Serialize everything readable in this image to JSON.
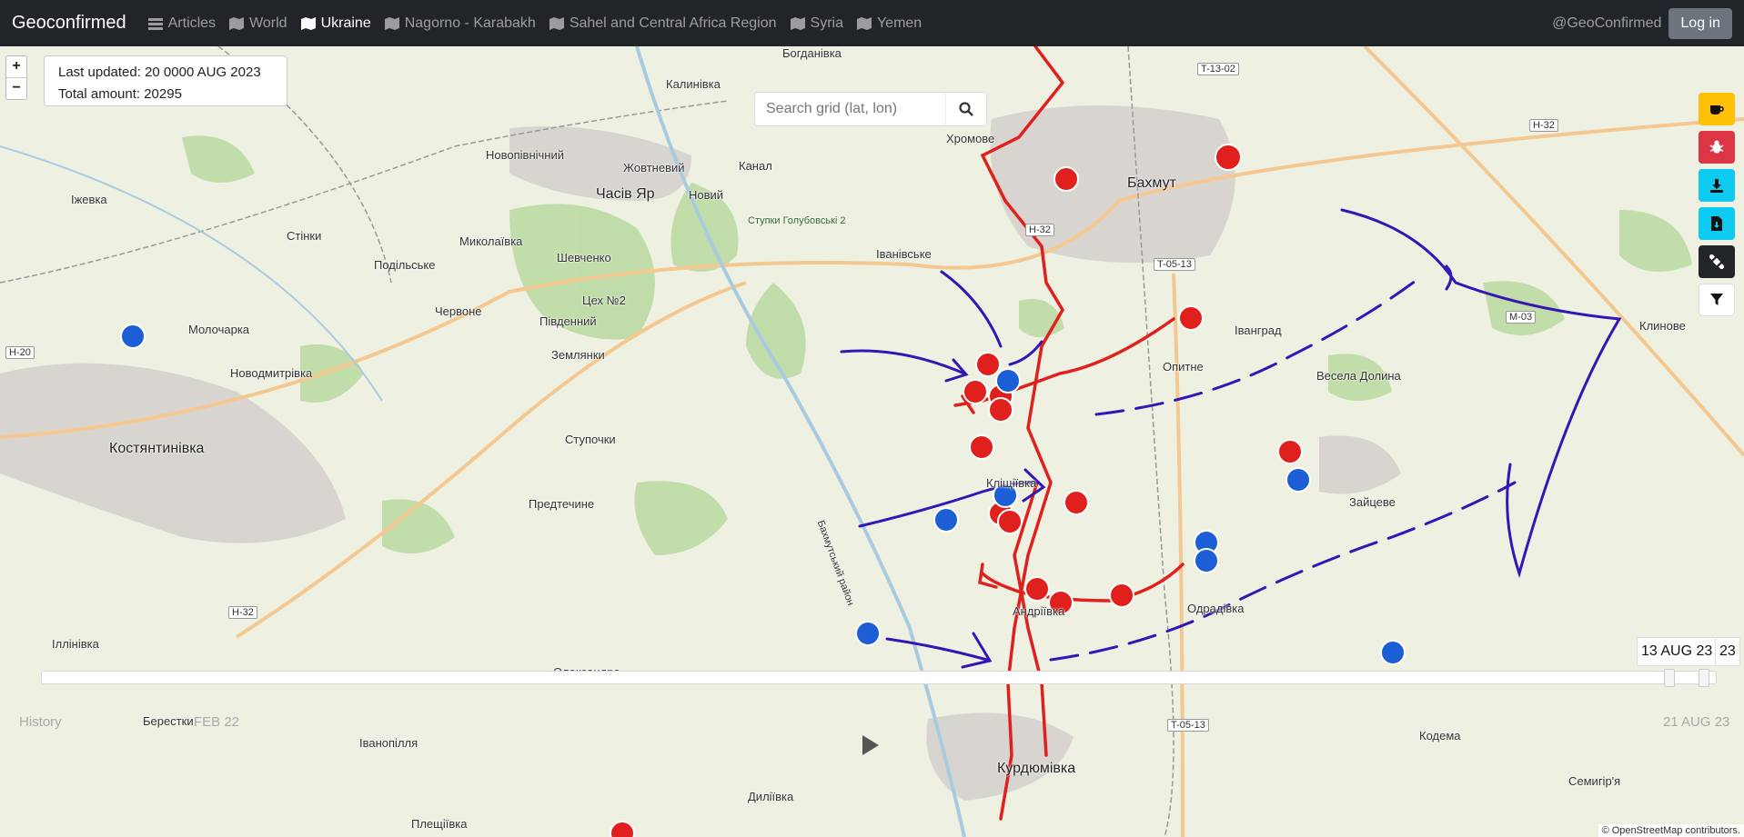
{
  "nav": {
    "brand": "Geoconfirmed",
    "items": [
      {
        "label": "Articles",
        "icon": "list-icon"
      },
      {
        "label": "World",
        "icon": "map-icon"
      },
      {
        "label": "Ukraine",
        "icon": "map-icon",
        "active": true
      },
      {
        "label": "Nagorno - Karabakh",
        "icon": "map-icon"
      },
      {
        "label": "Sahel and Central Africa Region",
        "icon": "map-icon"
      },
      {
        "label": "Syria",
        "icon": "map-icon"
      },
      {
        "label": "Yemen",
        "icon": "map-icon"
      }
    ],
    "handle": "@GeoConfirmed",
    "login": "Log in"
  },
  "info": {
    "last_updated": "Last updated: 20 0000 AUG 2023",
    "total": "Total amount: 20295"
  },
  "search": {
    "placeholder": "Search grid (lat, lon)"
  },
  "zoom": {
    "in": "+",
    "out": "−"
  },
  "sidebar": [
    {
      "icon": "coffee-icon",
      "color": "#ffc107"
    },
    {
      "icon": "bug-icon",
      "color": "#dc3545"
    },
    {
      "icon": "download-icon",
      "color": "#0dcaf0"
    },
    {
      "icon": "file-download-icon",
      "color": "#0dcaf0"
    },
    {
      "icon": "satellite-icon",
      "color": "#212529"
    },
    {
      "icon": "filter-icon",
      "color": "#ffffff"
    }
  ],
  "timeline": {
    "history": "History",
    "start": "FEB 22",
    "end": "21 AUG 23",
    "current_date": "13 AUG 23",
    "current_date_short": "23"
  },
  "attribution": "© OpenStreetMap contributors.",
  "places": [
    {
      "name": "Бахмут",
      "big": true
    },
    {
      "name": "Часів Яр",
      "big": true
    },
    {
      "name": "Костянтинівка",
      "big": true
    },
    {
      "name": "Курдюмівка",
      "big": true
    },
    {
      "name": "Богданівка"
    },
    {
      "name": "Калинівка"
    },
    {
      "name": "Хромове"
    },
    {
      "name": "Новопівнічний"
    },
    {
      "name": "Жовтневий"
    },
    {
      "name": "Канал"
    },
    {
      "name": "Новий"
    },
    {
      "name": "Ступки Голубовські 2"
    },
    {
      "name": "Іжевка"
    },
    {
      "name": "Стінки"
    },
    {
      "name": "Миколаївка"
    },
    {
      "name": "Подільське"
    },
    {
      "name": "Шевченко"
    },
    {
      "name": "Іванівське"
    },
    {
      "name": "Цех №2"
    },
    {
      "name": "Червоне"
    },
    {
      "name": "Молочарка"
    },
    {
      "name": "Південний"
    },
    {
      "name": "Землянки"
    },
    {
      "name": "Новодмитрівка"
    },
    {
      "name": "Ступочки"
    },
    {
      "name": "Предтечине"
    },
    {
      "name": "Кліщіївка"
    },
    {
      "name": "Іванград"
    },
    {
      "name": "Опитне"
    },
    {
      "name": "Весела Долина"
    },
    {
      "name": "Клинове"
    },
    {
      "name": "Зайцеве"
    },
    {
      "name": "Одрадівка"
    },
    {
      "name": "Андріївка"
    },
    {
      "name": "Іллінівка"
    },
    {
      "name": "Олександро-"
    },
    {
      "name": "Берестки"
    },
    {
      "name": "Іванопілля"
    },
    {
      "name": "Кодема"
    },
    {
      "name": "Семигір'я"
    },
    {
      "name": "Диліївка"
    },
    {
      "name": "Плещіївка"
    },
    {
      "name": "Бахмутський район"
    }
  ],
  "roads": [
    "T-13-02",
    "H-32",
    "H-32",
    "T-05-13",
    "H-32",
    "M-03",
    "H-20",
    "H-32",
    "T-05-13"
  ]
}
